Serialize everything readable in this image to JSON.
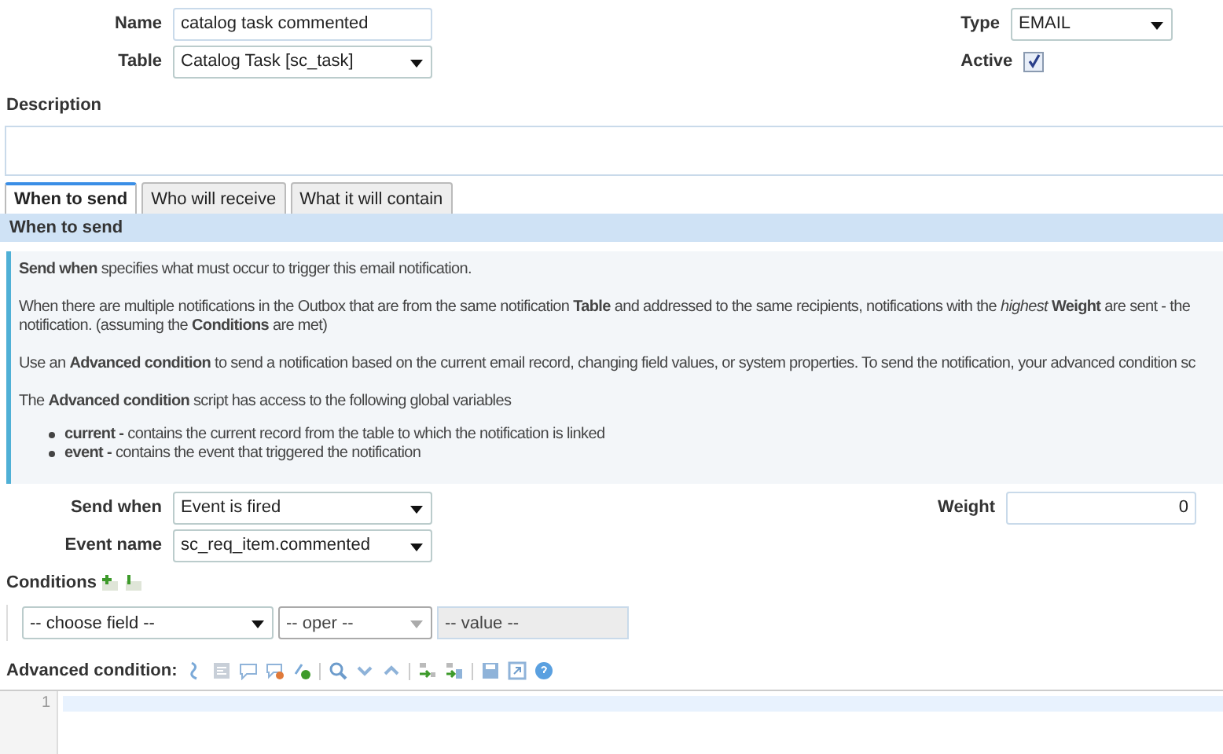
{
  "form": {
    "name": {
      "label": "Name",
      "value": "catalog task commented"
    },
    "table": {
      "label": "Table",
      "value": "Catalog Task [sc_task]"
    },
    "type": {
      "label": "Type",
      "value": "EMAIL"
    },
    "active": {
      "label": "Active",
      "checked": true
    },
    "description": {
      "label": "Description"
    }
  },
  "tabs": [
    {
      "label": "When to send",
      "selected": true
    },
    {
      "label": "Who will receive",
      "selected": false
    },
    {
      "label": "What it will contain",
      "selected": false
    }
  ],
  "section": {
    "title": "When to send",
    "paragraphs": [
      {
        "lines": [
          "**Send when** specifies what must occur to trigger this email notification."
        ]
      },
      {
        "lines": [
          "When there are multiple notifications in the Outbox that are from the same notification **Table** and addressed to the same recipients, notifications with the *highest* **Weight** are sent - the",
          "notification. (assuming the **Conditions** are met)"
        ]
      },
      {
        "lines": [
          "Use an **Advanced condition** to send a notification based on the current email record, changing field values, or system properties. To send the notification, your advanced condition sc"
        ]
      },
      {
        "lines": [
          "The **Advanced condition** script has access to the following global variables"
        ]
      }
    ],
    "bullets": [
      "**current -** contains the current record from the table to which the notification is linked",
      "**event -** contains the event that triggered the notification"
    ]
  },
  "send_when": {
    "label": "Send when",
    "value": "Event is fired"
  },
  "event_name": {
    "label": "Event name",
    "value": "sc_req_item.commented"
  },
  "weight": {
    "label": "Weight",
    "value": "0"
  },
  "conditions": {
    "label": "Conditions",
    "field": {
      "value": "-- choose field --",
      "disabled": false
    },
    "oper": {
      "value": "-- oper --",
      "disabled": true
    },
    "value": {
      "value": "-- value --",
      "disabled": true
    }
  },
  "advanced_condition": {
    "label": "Advanced condition:",
    "line_numbers": [
      "1"
    ]
  }
}
